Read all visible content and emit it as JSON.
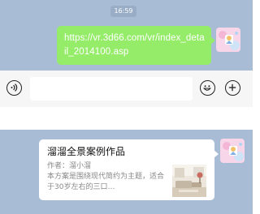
{
  "chat": {
    "timestamp": "16:59",
    "message_link": "https://vr.3d66.com/vr/index_detail_2014100.asp"
  },
  "input_bar": {
    "placeholder": "",
    "icons": [
      "voice-icon",
      "emoji-icon",
      "plus-icon"
    ]
  },
  "share_card": {
    "title": "溜溜全景案例作品",
    "author": "作者：溜小溜",
    "description": "本方案是围绕现代简约为主题，适合于30岁左右的三口…",
    "thumbnail_icon": "interior-room-thumbnail"
  },
  "colors": {
    "chat_background": "#a8bcd6",
    "bubble_green": "#95ec69",
    "input_bar": "#f6f6f6"
  }
}
